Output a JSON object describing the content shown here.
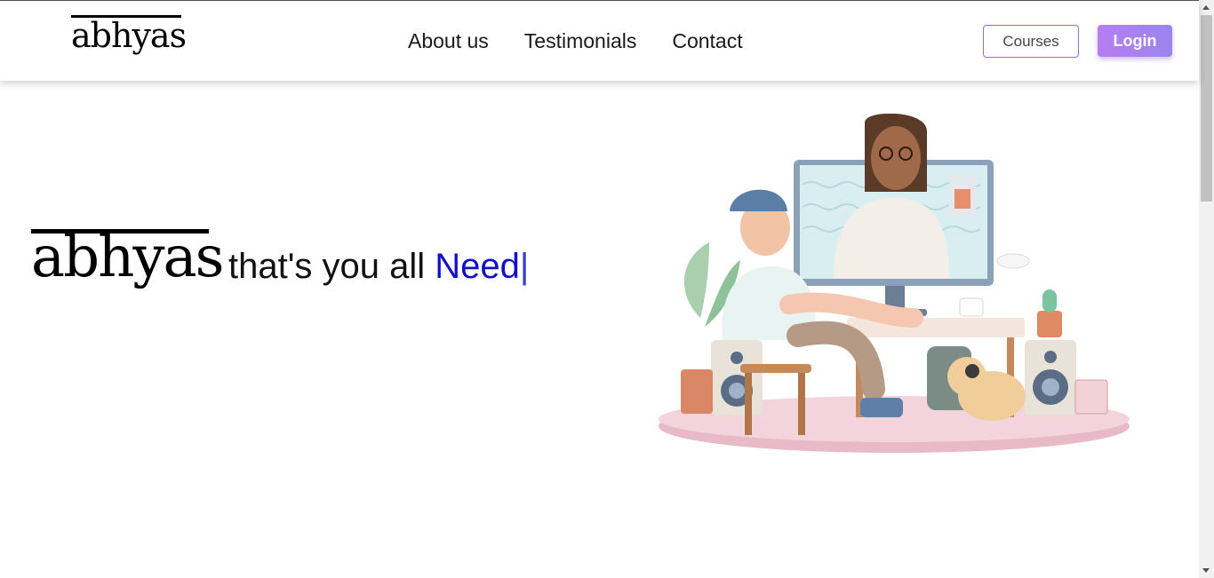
{
  "brand": {
    "logo_text": "abhyas"
  },
  "nav": {
    "links": [
      "About us",
      "Testimonials",
      "Contact"
    ]
  },
  "actions": {
    "courses_label": "Courses",
    "login_label": "Login"
  },
  "hero": {
    "logo_text": "abhyas",
    "tagline_prefix": "that's you all",
    "tagline_highlight": "Need",
    "cursor": "|"
  },
  "colors": {
    "accent": "#b67ef0",
    "highlight": "#1010c8",
    "platform": "#f3d3dc"
  }
}
